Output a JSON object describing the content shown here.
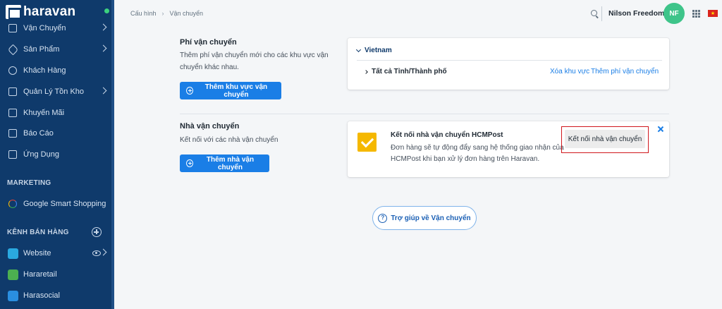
{
  "sidebar": {
    "logo_text": "haravan",
    "items": [
      {
        "label": "Vận Chuyển"
      },
      {
        "label": "Sản Phẩm"
      },
      {
        "label": "Khách Hàng"
      },
      {
        "label": "Quản Lý Tồn Kho"
      },
      {
        "label": "Khuyến Mãi"
      },
      {
        "label": "Báo Cáo"
      },
      {
        "label": "Ứng Dụng"
      }
    ],
    "marketing_header": "MARKETING",
    "marketing_items": [
      {
        "label": "Google Smart Shopping"
      }
    ],
    "sales_header": "KÊNH BÁN HÀNG",
    "sales_items": [
      {
        "label": "Website"
      },
      {
        "label": "Hararetail"
      },
      {
        "label": "Harasocial"
      }
    ]
  },
  "header": {
    "breadcrumb": [
      "Cấu hình",
      "Vận chuyển"
    ],
    "breadcrumb_sep": "›",
    "user_name": "Nilson Freedome",
    "avatar_initials": "NF"
  },
  "shipping_fee": {
    "title": "Phí vận chuyển",
    "description": "Thêm phí vận chuyển mới cho các khu vực vận chuyển khác nhau.",
    "button_label": "Thêm khu vực vận chuyển",
    "country": "Vietnam",
    "region": "Tất cả Tỉnh/Thành phố",
    "delete_link": "Xóa khu vực",
    "add_fee_link": "Thêm phí vận chuyển"
  },
  "carrier": {
    "title": "Nhà vận chuyển",
    "description": "Kết nối với các nhà vận chuyển",
    "button_label": "Thêm nhà vận chuyển",
    "card_title": "Kết nối nhà vận chuyển HCMPost",
    "card_desc": "Đơn hàng sẽ tự động đẩy sang hệ thống giao nhận của HCMPost khi bạn xử lý đơn hàng trên Haravan.",
    "connect_label": "Kết nối nhà vận chuyển"
  },
  "help": {
    "label": "Trợ giúp về Vận chuyển",
    "icon_glyph": "?"
  },
  "colors": {
    "sidebar_bg": "#0f3a6b",
    "primary": "#1a7ee6",
    "avatar": "#3ec48a",
    "highlight": "#d0171c"
  }
}
